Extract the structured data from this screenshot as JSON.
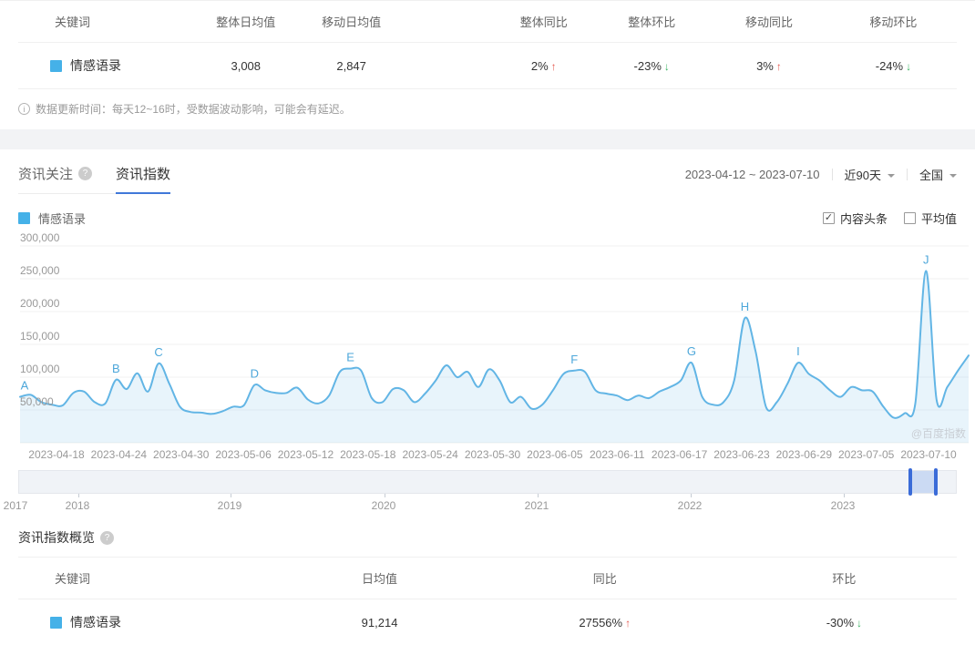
{
  "colors": {
    "accent_blue": "#4078d9",
    "keyword_swatch": "#45b1e8",
    "line_blue": "#62b5e5",
    "up_red": "#e4584e",
    "down_green": "#39b362",
    "slider_handle_blue": "#3a6bd8"
  },
  "top_table": {
    "headers": [
      "关键词",
      "整体日均值",
      "移动日均值",
      "整体同比",
      "整体环比",
      "移动同比",
      "移动环比"
    ],
    "row": {
      "keyword": "情感语录",
      "overall_daily": "3,008",
      "mobile_daily": "2,847",
      "overall_yoy": {
        "value": "2%",
        "direction": "up"
      },
      "overall_mom": {
        "value": "-23%",
        "direction": "down"
      },
      "mobile_yoy": {
        "value": "3%",
        "direction": "up"
      },
      "mobile_mom": {
        "value": "-24%",
        "direction": "down"
      }
    },
    "note": "数据更新时间：每天12~16时，受数据波动影响，可能会有延迟。"
  },
  "tabs": {
    "inactive": "资讯关注",
    "active": "资讯指数",
    "help_glyph": "?"
  },
  "controls": {
    "date_range": "2023-04-12 ~ 2023-07-10",
    "period": "近90天",
    "region": "全国"
  },
  "legend": {
    "keyword": "情感语录",
    "checkbox_checked": "内容头条",
    "checkbox_unchecked": "平均值",
    "check_glyph": "✓"
  },
  "watermark": "@百度指数",
  "chart_data": {
    "type": "area",
    "title": "资讯指数",
    "smooth": true,
    "grid": true,
    "area_fill": true,
    "legend": [
      "情感语录"
    ],
    "legend_position": "top-left",
    "x_start": "2023-04-12",
    "x_end": "2023-07-10",
    "ylim": [
      0,
      300000
    ],
    "y_ticks": [
      {
        "value": 50000,
        "label": "50,000"
      },
      {
        "value": 100000,
        "label": "100,000"
      },
      {
        "value": 150000,
        "label": "150,000"
      },
      {
        "value": 200000,
        "label": "200,000"
      },
      {
        "value": 250000,
        "label": "250,000"
      },
      {
        "value": 300000,
        "label": "300,000"
      }
    ],
    "x_tick_labels": [
      "2023-04-18",
      "2023-04-24",
      "2023-04-30",
      "2023-05-06",
      "2023-05-12",
      "2023-05-18",
      "2023-05-24",
      "2023-05-30",
      "2023-06-05",
      "2023-06-11",
      "2023-06-17",
      "2023-06-23",
      "2023-06-29",
      "2023-07-05",
      "2023-07-10"
    ],
    "series": [
      {
        "name": "情感语录",
        "values": [
          70000,
          73000,
          62000,
          58000,
          57000,
          76000,
          78000,
          62000,
          60000,
          96000,
          82000,
          106000,
          78000,
          121000,
          90000,
          55000,
          47000,
          46000,
          44000,
          48000,
          55000,
          57000,
          88000,
          80000,
          76000,
          76000,
          84000,
          66000,
          60000,
          72000,
          108000,
          113000,
          110000,
          68000,
          62000,
          82000,
          80000,
          62000,
          75000,
          95000,
          118000,
          100000,
          108000,
          85000,
          112000,
          95000,
          62000,
          70000,
          52000,
          58000,
          80000,
          105000,
          110000,
          108000,
          80000,
          75000,
          72000,
          65000,
          72000,
          68000,
          78000,
          85000,
          95000,
          122000,
          70000,
          58000,
          62000,
          95000,
          190000,
          140000,
          54000,
          62000,
          90000,
          122000,
          105000,
          95000,
          80000,
          70000,
          85000,
          80000,
          78000,
          55000,
          38000,
          45000,
          60000,
          262000,
          65000,
          85000,
          110000,
          133000
        ]
      }
    ],
    "markers": [
      {
        "label": "A",
        "index": 0
      },
      {
        "label": "B",
        "index": 9
      },
      {
        "label": "C",
        "index": 13
      },
      {
        "label": "D",
        "index": 22
      },
      {
        "label": "E",
        "index": 31
      },
      {
        "label": "F",
        "index": 52
      },
      {
        "label": "G",
        "index": 63
      },
      {
        "label": "H",
        "index": 68
      },
      {
        "label": "I",
        "index": 73
      },
      {
        "label": "J",
        "index": 85
      }
    ]
  },
  "timeline": {
    "years": [
      "2017",
      "2018",
      "2019",
      "2020",
      "2021",
      "2022",
      "2023"
    ],
    "selection": {
      "start_pct": 95.1,
      "end_pct": 97.9
    }
  },
  "overview": {
    "title": "资讯指数概览",
    "headers": [
      "关键词",
      "日均值",
      "同比",
      "环比"
    ],
    "row": {
      "keyword": "情感语录",
      "daily_avg": "91,214",
      "yoy": {
        "value": "27556%",
        "direction": "up"
      },
      "mom": {
        "value": "-30%",
        "direction": "down"
      }
    }
  }
}
